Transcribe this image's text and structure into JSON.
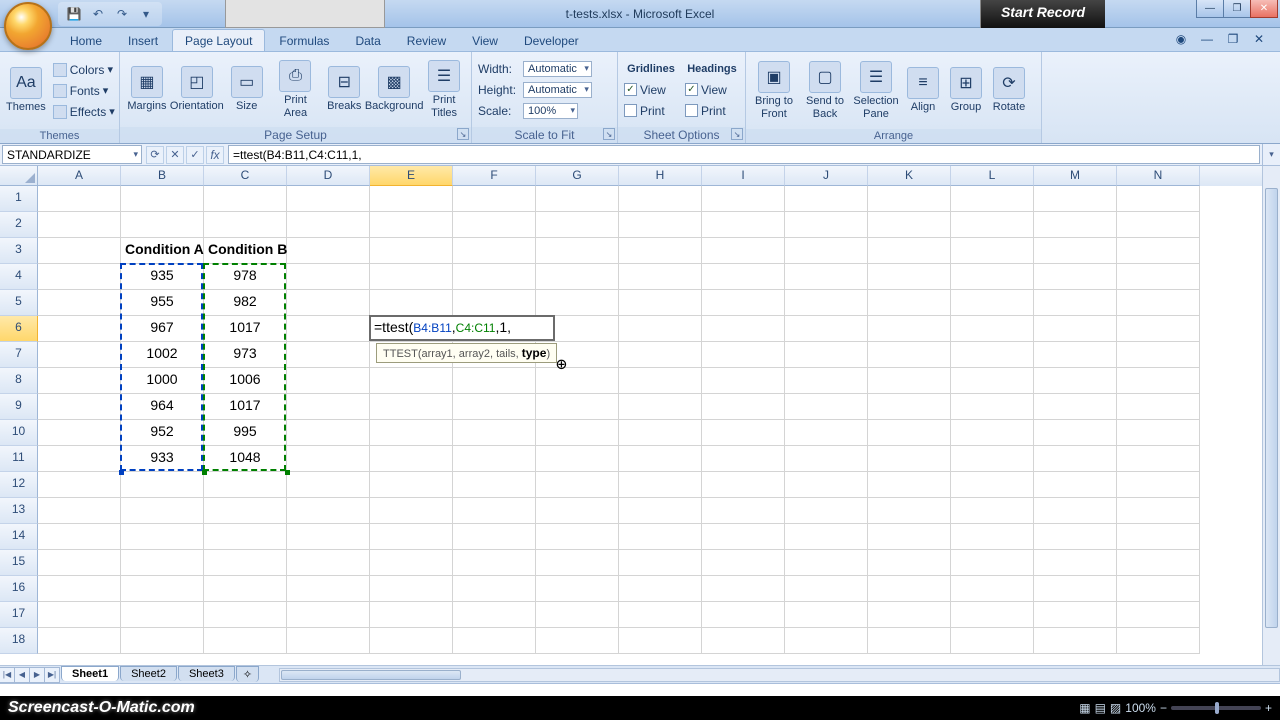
{
  "title": {
    "file": "t-tests.xlsx",
    "app": "Microsoft Excel"
  },
  "overlay": {
    "start_record": "Start Record"
  },
  "qat": {
    "save": "💾",
    "undo": "↶",
    "redo": "↷"
  },
  "tabs": {
    "home": "Home",
    "insert": "Insert",
    "page_layout": "Page Layout",
    "formulas": "Formulas",
    "data": "Data",
    "review": "Review",
    "view": "View",
    "developer": "Developer"
  },
  "ribbon": {
    "themes": {
      "btn": "Themes",
      "colors": "Colors",
      "fonts": "Fonts",
      "effects": "Effects",
      "group": "Themes"
    },
    "page_setup": {
      "margins": "Margins",
      "orientation": "Orientation",
      "size": "Size",
      "print_area": "Print\nArea",
      "breaks": "Breaks",
      "background": "Background",
      "print_titles": "Print\nTitles",
      "group": "Page Setup"
    },
    "scale": {
      "width": "Width:",
      "width_val": "Automatic",
      "height": "Height:",
      "height_val": "Automatic",
      "scale": "Scale:",
      "scale_val": "100%",
      "group": "Scale to Fit"
    },
    "sheet_opt": {
      "gridlines": "Gridlines",
      "headings": "Headings",
      "view": "View",
      "print": "Print",
      "group": "Sheet Options"
    },
    "arrange": {
      "front": "Bring to\nFront",
      "back": "Send to\nBack",
      "selpane": "Selection\nPane",
      "align": "Align",
      "group_btn": "Group",
      "rotate": "Rotate",
      "group": "Arrange"
    }
  },
  "fx": {
    "namebox": "STANDARDIZE",
    "formula": "=ttest(B4:B11,C4:C11,1,"
  },
  "columns": [
    "A",
    "B",
    "C",
    "D",
    "E",
    "F",
    "G",
    "H",
    "I",
    "J",
    "K",
    "L",
    "M",
    "N"
  ],
  "rows": [
    "1",
    "2",
    "3",
    "4",
    "5",
    "6",
    "7",
    "8",
    "9",
    "10",
    "11",
    "12",
    "13",
    "14",
    "15",
    "16",
    "17",
    "18"
  ],
  "data": {
    "B3": "Condition A",
    "C3": "Condition B",
    "B4": "935",
    "C4": "978",
    "B5": "955",
    "C5": "982",
    "B6": "967",
    "C6": "1017",
    "B7": "1002",
    "C7": "973",
    "B8": "1000",
    "C8": "1006",
    "B9": "964",
    "C9": "1017",
    "B10": "952",
    "C10": "995",
    "B11": "933",
    "C11": "1048"
  },
  "edit": {
    "prefix": "=ttest(",
    "arr1": "B4:B11",
    "arr2": "C4:C11",
    "tails": "1",
    "tooltip": {
      "name": "TTEST",
      "sig": "(array1, array2, tails, ",
      "bold": "type",
      "suffix": ")"
    }
  },
  "sheets": {
    "s1": "Sheet1",
    "s2": "Sheet2",
    "s3": "Sheet3"
  },
  "footer": {
    "som": "Screencast-O-Matic.com",
    "zoom": "100%"
  }
}
